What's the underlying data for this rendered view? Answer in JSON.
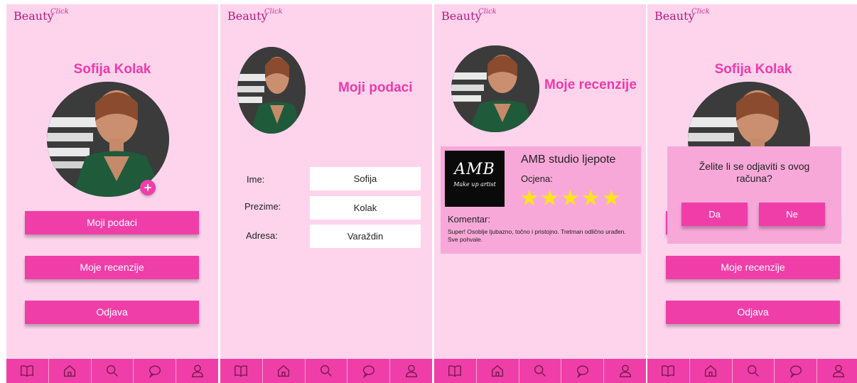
{
  "app": {
    "logo_main": "Beauty",
    "logo_sup": "Click"
  },
  "profile": {
    "name": "Sofija Kolak",
    "add_photo_symbol": "+",
    "menu": [
      "Moji podaci",
      "Moje recenzije",
      "Odjava"
    ]
  },
  "my_data": {
    "title": "Moji podaci",
    "fields": [
      {
        "label": "Ime:",
        "value": "Sofija"
      },
      {
        "label": "Prezime:",
        "value": "Kolak"
      },
      {
        "label": "Adresa:",
        "value": "Varaždin"
      }
    ]
  },
  "my_reviews": {
    "title": "Moje recenzije",
    "reviews": [
      {
        "logo_text": "AMB",
        "logo_subtext": "Make up artist",
        "salon": "AMB studio ljepote",
        "rating_label": "Ocjena:",
        "rating": 5,
        "rating_max": 5,
        "stars_display": "★★★★★",
        "comment_label": "Komentar:",
        "comment": "Super! Osoblje ljubazno, točno i pristojno. Tretman odlično urađen. Sve pohvale."
      }
    ]
  },
  "logout_dialog": {
    "message": "Želite li se odjaviti s ovog računa?",
    "yes": "Da",
    "no": "Ne"
  },
  "nav_icons": [
    "book-icon",
    "home-icon",
    "search-icon",
    "chat-icon",
    "user-icon"
  ],
  "colors": {
    "screen_bg": "#fed4ec",
    "accent": "#f03ea8",
    "title": "#ee3aa8",
    "card_bg": "#f7a8d9",
    "star": "#fbe31e"
  }
}
